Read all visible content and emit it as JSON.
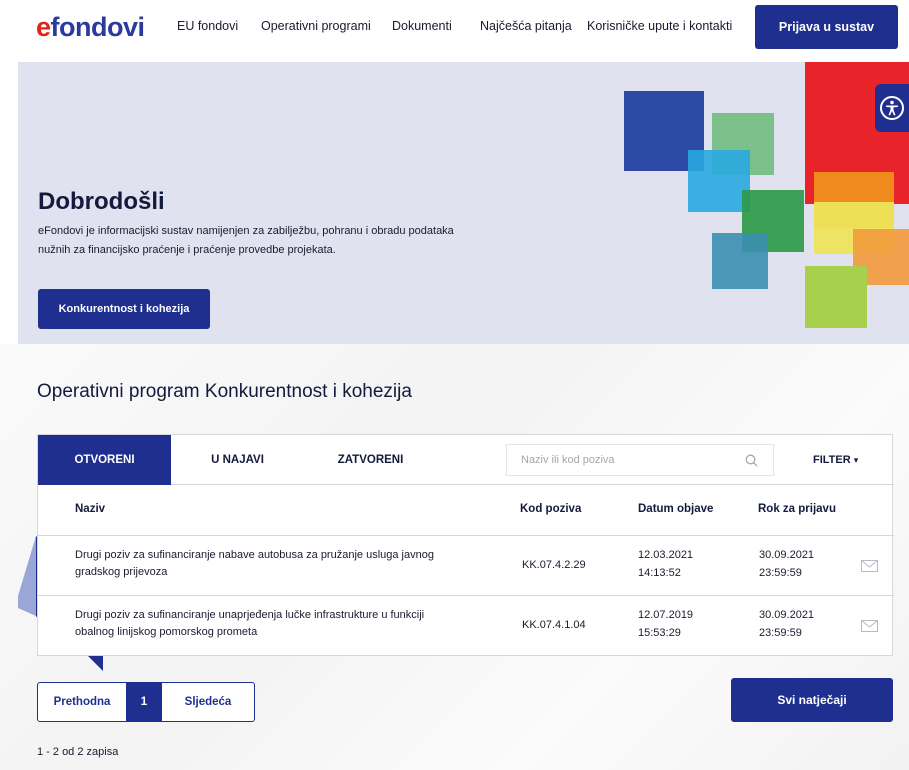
{
  "header": {
    "logo_e": "e",
    "logo_rest": "fondovi",
    "nav": [
      "EU fondovi",
      "Operativni programi",
      "Dokumenti",
      "Najčešća pitanja",
      "Korisničke upute i kontakti"
    ],
    "login_label": "Prijava u sustav"
  },
  "hero": {
    "title": "Dobrodošli",
    "description": "eFondovi je informacijski sustav namijenjen za zabilježbu, pohranu i obradu podataka nužnih za financijsko praćenje i praćenje provedbe projekata.",
    "button_label": "Konkurentnost i kohezija"
  },
  "section": {
    "title": "Operativni program Konkurentnost i kohezija"
  },
  "tabs": [
    "OTVORENI",
    "U NAJAVI",
    "ZATVORENI"
  ],
  "search": {
    "placeholder": "Naziv ili kod poziva"
  },
  "filter_label": "FILTER",
  "table": {
    "headers": [
      "Naziv",
      "Kod poziva",
      "Datum objave",
      "Rok za prijavu"
    ],
    "rows": [
      {
        "name": "Drugi poziv za sufinanciranje nabave autobusa za pružanje usluga javnog gradskog prijevoza",
        "code": "KK.07.4.2.29",
        "published_date": "12.03.2021",
        "published_time": "14:13:52",
        "deadline_date": "30.09.2021",
        "deadline_time": "23:59:59"
      },
      {
        "name": "Drugi poziv za sufinanciranje unaprjeđenja lučke infrastrukture u funkciji obalnog linijskog pomorskog prometa",
        "code": "KK.07.4.1.04",
        "published_date": "12.07.2019",
        "published_time": "15:53:29",
        "deadline_date": "30.09.2021",
        "deadline_time": "23:59:59"
      }
    ]
  },
  "pagination": {
    "prev": "Prethodna",
    "current": "1",
    "next": "Sljedeća"
  },
  "all_calls_label": "Svi natječaji",
  "records_text": "1 - 2 od 2 zapisa",
  "colors": {
    "brand_blue": "#1f2f8f",
    "logo_red": "#e2231a",
    "hero_bg": "#e1e2f0"
  },
  "icons": [
    "accessibility-icon",
    "search-icon",
    "caret-down-icon",
    "mail-icon"
  ]
}
